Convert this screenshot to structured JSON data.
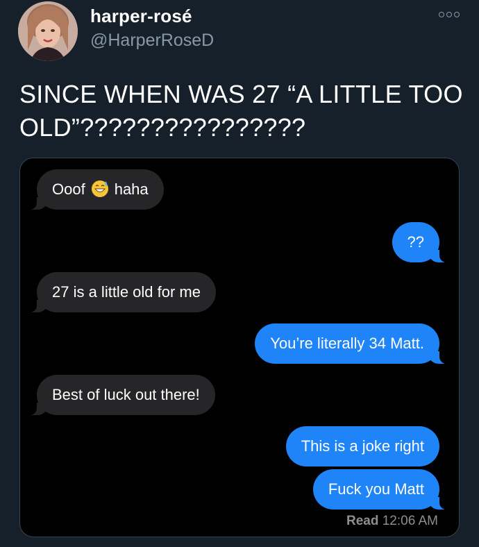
{
  "tweet": {
    "author": {
      "display_name": "harper-rosé",
      "handle": "@HarperRoseD",
      "avatar_icon": "profile-photo"
    },
    "more_icon": "more-options-icon",
    "text": "SINCE WHEN WAS 27 “A LITTLE TOO OLD”????????????????"
  },
  "conversation": {
    "messages": [
      {
        "direction": "incoming",
        "text_before": "Ooof",
        "emoji": "grinning-sweat-emoji",
        "text_after": "haha"
      },
      {
        "direction": "outgoing",
        "text": "??"
      },
      {
        "direction": "incoming",
        "text": "27 is a little old for me"
      },
      {
        "direction": "outgoing",
        "text": "You’re literally 34 Matt."
      },
      {
        "direction": "incoming",
        "text": "Best of luck out there!"
      },
      {
        "direction": "outgoing",
        "text": "This is a joke right"
      },
      {
        "direction": "outgoing",
        "text": "Fuck you Matt"
      }
    ],
    "read_label": "Read",
    "read_time": "12:06 AM"
  },
  "colors": {
    "background": "#15202b",
    "secondary_text": "#8899a6",
    "incoming_bubble": "#262628",
    "outgoing_bubble": "#1e84f7"
  }
}
